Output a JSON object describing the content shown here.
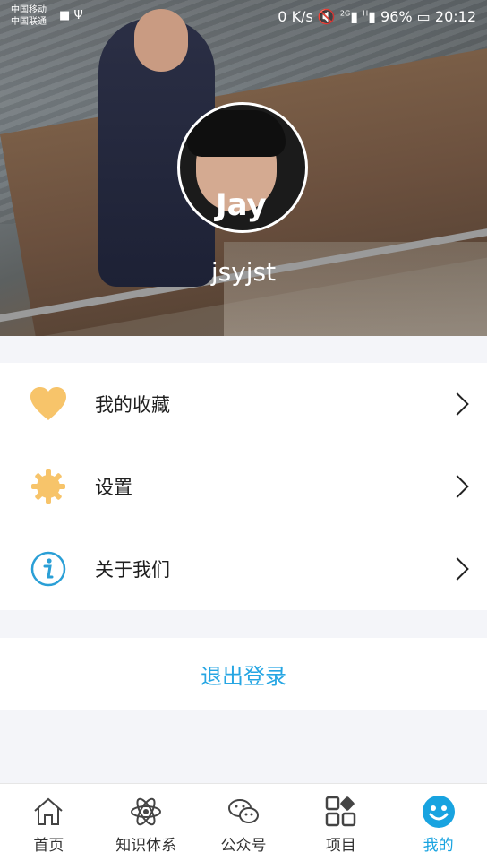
{
  "status_bar": {
    "carrier1": "中国移动",
    "carrier2": "中国联通",
    "network_speed": "0 K/s",
    "signal_2g": "2G",
    "signal_h": "H",
    "battery": "96%",
    "time": "20:12"
  },
  "profile": {
    "avatar_text": "Jay",
    "username": "jsyjst"
  },
  "menu": [
    {
      "label": "我的收藏",
      "icon": "heart-icon",
      "color": "#f7c46a"
    },
    {
      "label": "设置",
      "icon": "gear-icon",
      "color": "#f7c46a"
    },
    {
      "label": "关于我们",
      "icon": "info-icon",
      "color": "#2a9fd6"
    }
  ],
  "logout": {
    "label": "退出登录",
    "color": "#26a6e3"
  },
  "bottom_nav": [
    {
      "label": "首页",
      "icon": "home-icon",
      "active": false
    },
    {
      "label": "知识体系",
      "icon": "atom-icon",
      "active": false
    },
    {
      "label": "公众号",
      "icon": "wechat-icon",
      "active": false
    },
    {
      "label": "项目",
      "icon": "grid-icon",
      "active": false
    },
    {
      "label": "我的",
      "icon": "smile-icon",
      "active": true
    }
  ]
}
